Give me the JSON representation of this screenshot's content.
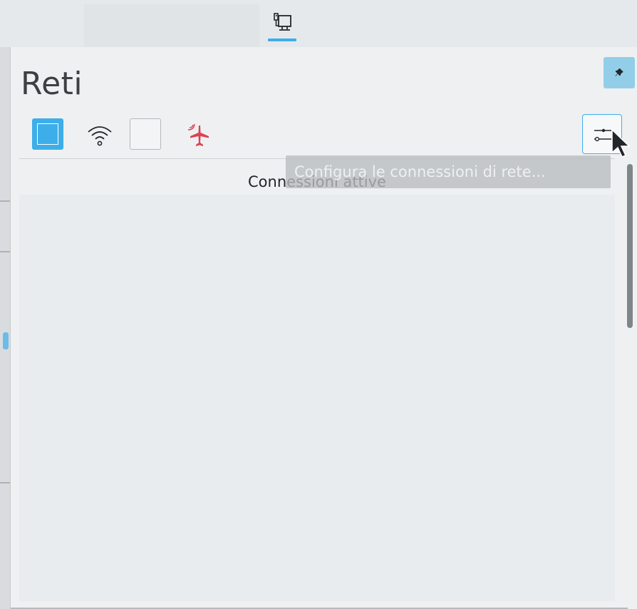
{
  "tray": {
    "active_icon": "network-wired-icon",
    "active_indicator_color": "#3daee9"
  },
  "panel": {
    "title": "Reti",
    "pin_icon": "pin-icon"
  },
  "toolbar": {
    "wired_toggle": {
      "icon": "wired-toggle-icon",
      "state": "enabled",
      "color": "#3daee9"
    },
    "wireless_icon": "wifi-icon",
    "wireless_toggle": {
      "icon": "wifi-toggle-icon",
      "state": "disabled"
    },
    "airplane_icon": {
      "icon": "airplane-mode-icon",
      "color": "#da4453"
    },
    "configure_button": {
      "icon": "sliders-icon"
    }
  },
  "connections": {
    "header": "Connessioni attive",
    "items": []
  },
  "tooltip": {
    "text": "Configura le connessioni di rete..."
  }
}
